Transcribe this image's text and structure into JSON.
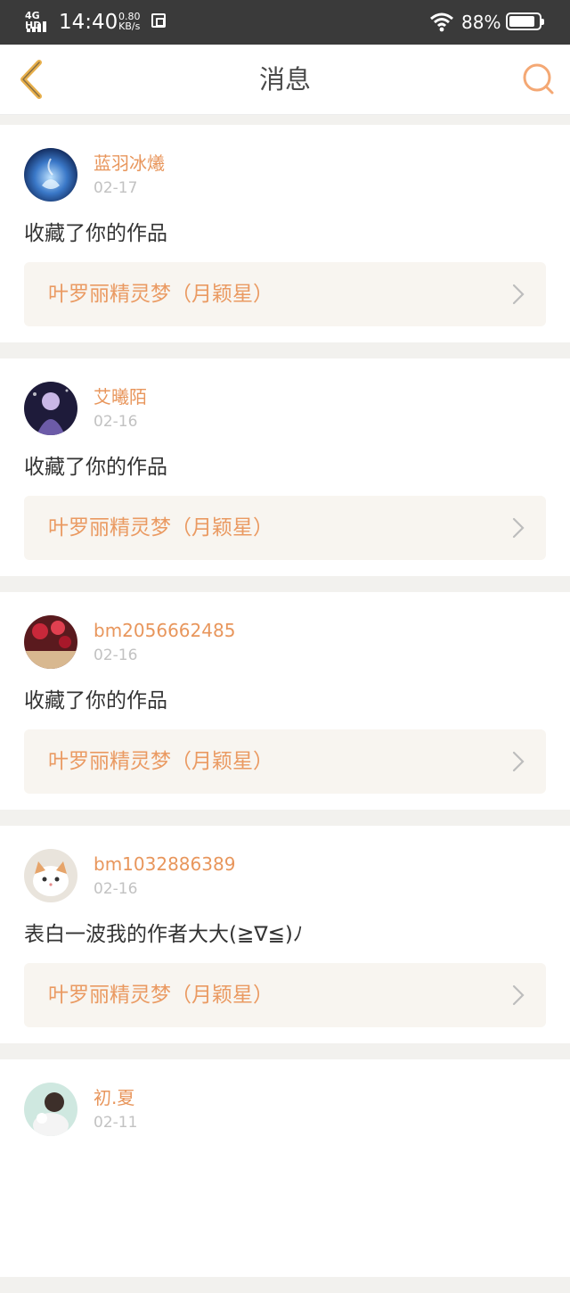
{
  "status_bar": {
    "network": "4G HD",
    "time": "14:40",
    "speed_value": "0.80",
    "speed_unit": "KB/s",
    "battery": "88%",
    "battery_level": 0.88
  },
  "header": {
    "title": "消息",
    "back_icon": "chevron-left-icon",
    "search_icon": "search-icon",
    "accent_color": "#e8b04c"
  },
  "messages": [
    {
      "user": "蓝羽冰爔",
      "date": "02-17",
      "text": "收藏了你的作品",
      "work": "叶罗丽精灵梦（月颖星）"
    },
    {
      "user": "艾曦陌",
      "date": "02-16",
      "text": "收藏了你的作品",
      "work": "叶罗丽精灵梦（月颖星）"
    },
    {
      "user": "bm2056662485",
      "date": "02-16",
      "text": "收藏了你的作品",
      "work": "叶罗丽精灵梦（月颖星）"
    },
    {
      "user": "bm1032886389",
      "date": "02-16",
      "text": "表白一波我的作者大大(≧∇≦)ﾉ",
      "work": "叶罗丽精灵梦（月颖星）"
    },
    {
      "user": "初.夏",
      "date": "02-11"
    }
  ],
  "colors": {
    "username": "#e8965c",
    "work_title": "#ea9a62",
    "work_bg": "#f8f5f0"
  }
}
